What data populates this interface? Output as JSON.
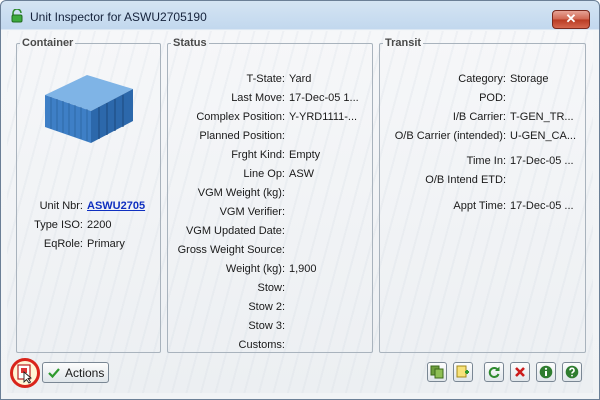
{
  "window": {
    "title": "Unit Inspector for ASWU2705190",
    "close_label": "✕"
  },
  "container_panel": {
    "legend": "Container",
    "fields": [
      {
        "label": "Unit Nbr:",
        "value": "ASWU2705"
      },
      {
        "label": "Type ISO:",
        "value": "2200"
      },
      {
        "label": "EqRole:",
        "value": "Primary"
      }
    ]
  },
  "status_panel": {
    "legend": "Status",
    "fields": [
      {
        "label": "T-State:",
        "value": "Yard"
      },
      {
        "label": "Last Move:",
        "value": "17-Dec-05 1..."
      },
      {
        "label": "Complex Position:",
        "value": "Y-YRD1111-..."
      },
      {
        "label": "Planned Position:",
        "value": ""
      },
      {
        "label": "Frght Kind:",
        "value": "Empty"
      },
      {
        "label": "Line Op:",
        "value": "ASW"
      },
      {
        "label": "VGM Weight (kg):",
        "value": ""
      },
      {
        "label": "VGM Verifier:",
        "value": ""
      },
      {
        "label": "VGM Updated Date:",
        "value": ""
      },
      {
        "label": "Gross Weight Source:",
        "value": ""
      },
      {
        "label": "Weight (kg):",
        "value": "1,900"
      },
      {
        "label": "Stow:",
        "value": ""
      },
      {
        "label": "Stow 2:",
        "value": ""
      },
      {
        "label": "Stow 3:",
        "value": ""
      },
      {
        "label": "Customs:",
        "value": ""
      }
    ]
  },
  "transit_panel": {
    "legend": "Transit",
    "fields": [
      {
        "label": "Category:",
        "value": "Storage"
      },
      {
        "label": "POD:",
        "value": ""
      },
      {
        "label": "I/B Carrier:",
        "value": "T-GEN_TR..."
      },
      {
        "label": "O/B Carrier (intended):",
        "value": "U-GEN_CA..."
      },
      {
        "label": "Time In:",
        "value": "17-Dec-05 ..."
      },
      {
        "label": "O/B Intend ETD:",
        "value": ""
      },
      {
        "label": "Appt Time:",
        "value": "17-Dec-05 ..."
      }
    ]
  },
  "toolbar": {
    "actions_label": "Actions"
  },
  "colors": {
    "highlight": "#d9241b",
    "link": "#1030c0"
  }
}
